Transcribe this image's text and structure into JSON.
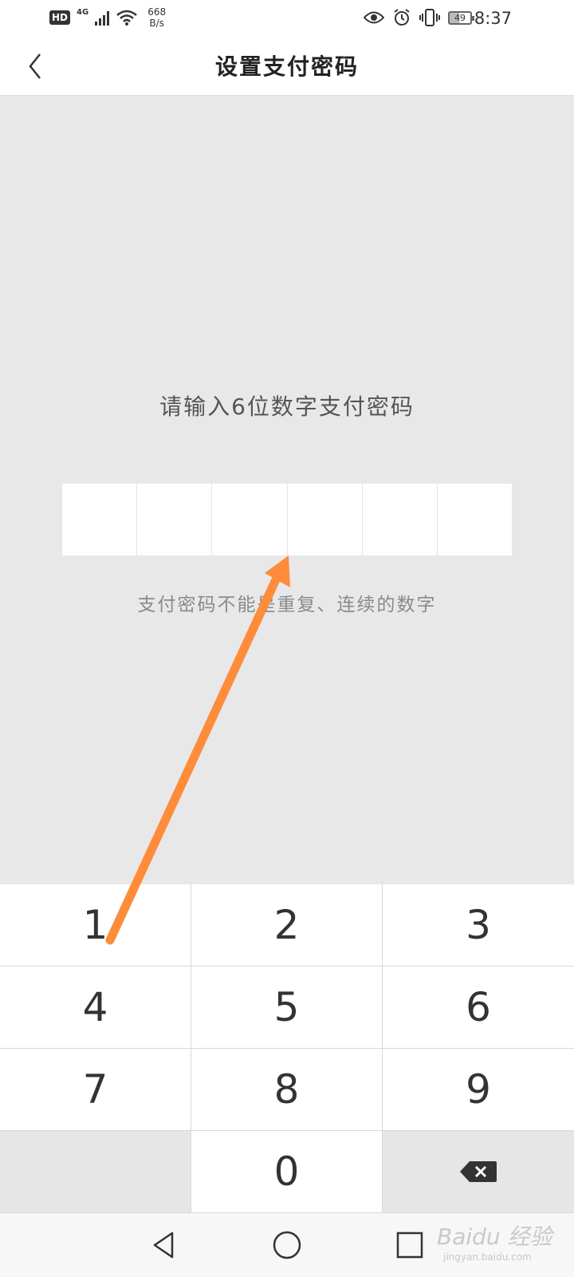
{
  "status_bar": {
    "hd": "HD",
    "network": "4G",
    "speed_value": "668",
    "speed_unit": "B/s",
    "battery": "49",
    "time": "8:37"
  },
  "header": {
    "title": "设置支付密码"
  },
  "main": {
    "prompt": "请输入6位数字支付密码",
    "hint": "支付密码不能是重复、连续的数字",
    "pin_length": 6
  },
  "keypad": {
    "keys": [
      "1",
      "2",
      "3",
      "4",
      "5",
      "6",
      "7",
      "8",
      "9",
      "",
      "0",
      "delete"
    ]
  },
  "annotation": {
    "arrow_color": "#FF8C3A"
  },
  "watermark": {
    "text": "Baidu 经验",
    "sub": "jingyan.baidu.com"
  }
}
